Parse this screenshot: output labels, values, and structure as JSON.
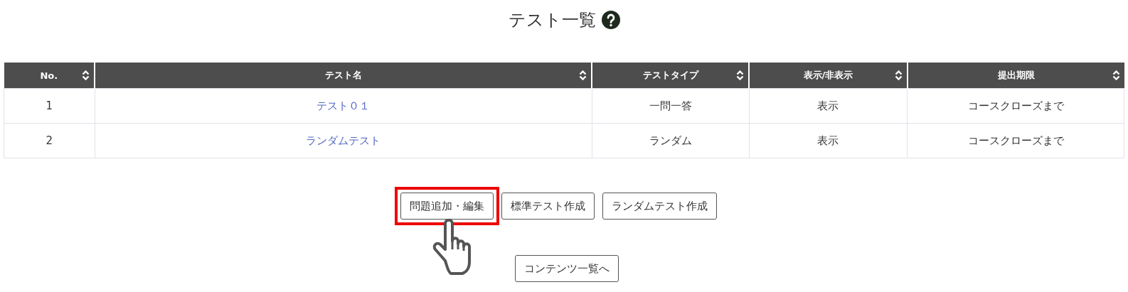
{
  "title": "テスト一覧",
  "help_icon": true,
  "table": {
    "columns": [
      {
        "label": "No.",
        "sortable": true
      },
      {
        "label": "テスト名",
        "sortable": true
      },
      {
        "label": "テストタイプ",
        "sortable": true
      },
      {
        "label": "表示/非表示",
        "sortable": true
      },
      {
        "label": "提出期限",
        "sortable": true
      }
    ],
    "rows": [
      {
        "no": "1",
        "name": "テスト０１",
        "type": "一問一答",
        "visibility": "表示",
        "deadline": "コースクローズまで"
      },
      {
        "no": "2",
        "name": "ランダムテスト",
        "type": "ランダム",
        "visibility": "表示",
        "deadline": "コースクローズまで"
      }
    ]
  },
  "buttons": [
    {
      "label": "問題追加・編集",
      "highlighted": true
    },
    {
      "label": "標準テスト作成",
      "highlighted": false
    },
    {
      "label": "ランダムテスト作成",
      "highlighted": false
    }
  ],
  "footer_button": {
    "label": "コンテンツ一覧へ"
  }
}
